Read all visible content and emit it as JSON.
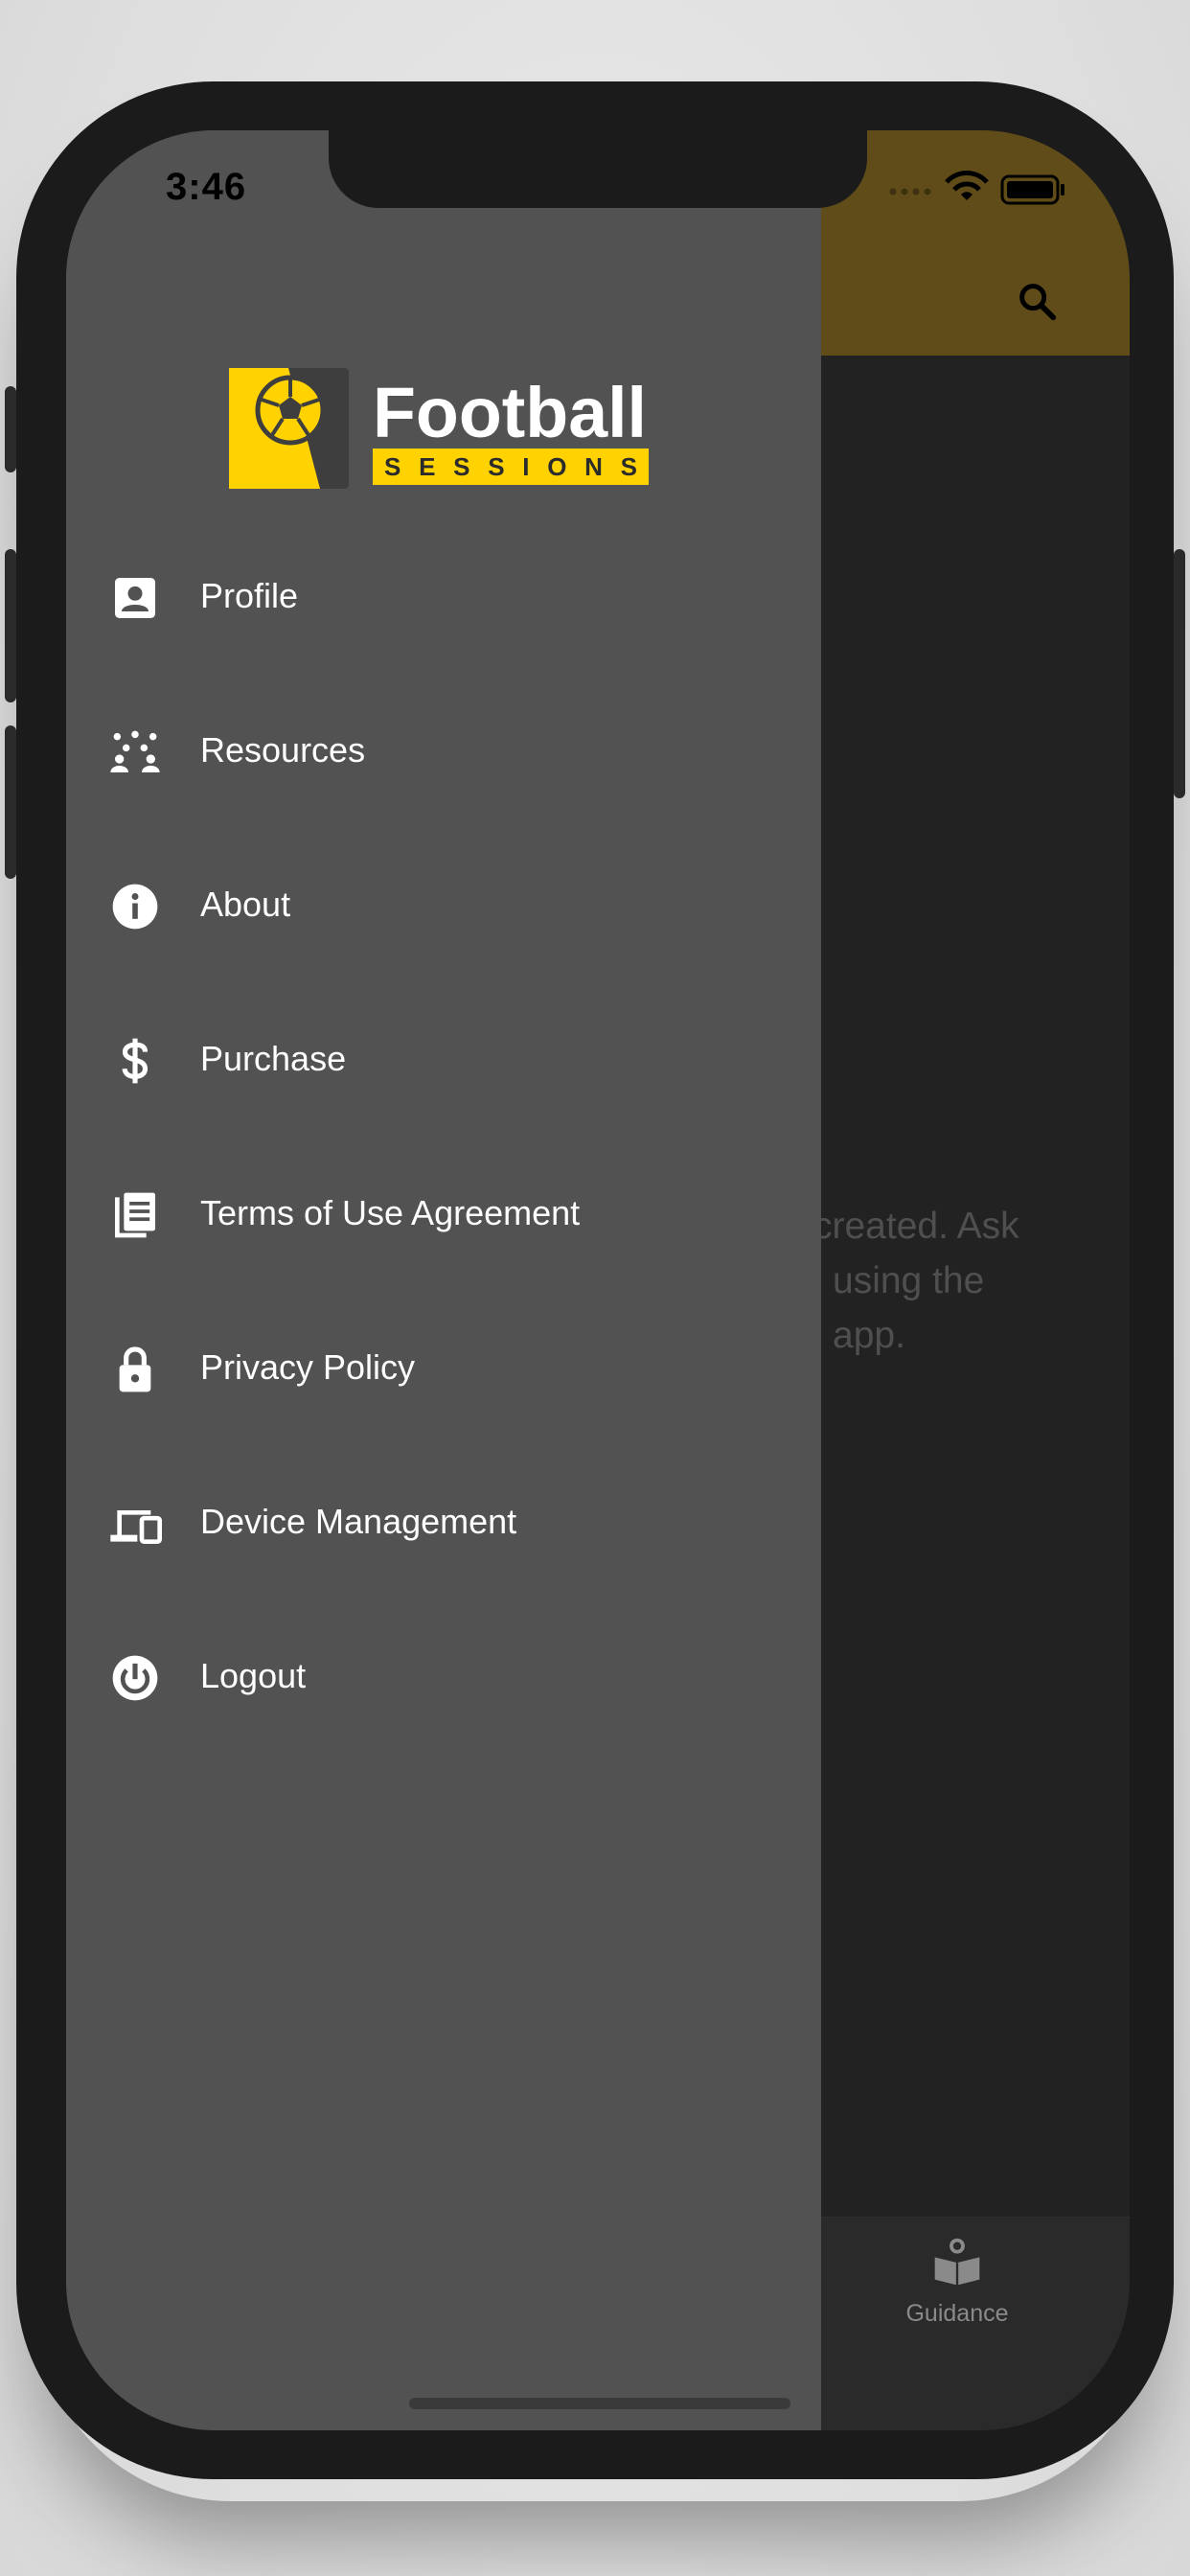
{
  "status_bar": {
    "time": "3:46"
  },
  "brand": {
    "line1": "Football",
    "line2": "SESSIONS"
  },
  "background": {
    "message_lines": [
      "created. Ask",
      "using the",
      "app."
    ],
    "tab": {
      "label": "Guidance",
      "icon": "book-icon"
    }
  },
  "drawer": {
    "items": [
      {
        "label": "Profile",
        "icon": "profile-icon"
      },
      {
        "label": "Resources",
        "icon": "resources-icon"
      },
      {
        "label": "About",
        "icon": "info-icon"
      },
      {
        "label": "Purchase",
        "icon": "dollar-icon"
      },
      {
        "label": "Terms of Use Agreement",
        "icon": "document-icon"
      },
      {
        "label": "Privacy Policy",
        "icon": "lock-icon"
      },
      {
        "label": "Device Management",
        "icon": "devices-icon"
      },
      {
        "label": "Logout",
        "icon": "power-icon"
      }
    ]
  },
  "colors": {
    "brand_yellow": "#ffd200",
    "drawer_bg": "#525252",
    "header_dimmed": "#5f4c18",
    "screen_bg": "#222222"
  }
}
